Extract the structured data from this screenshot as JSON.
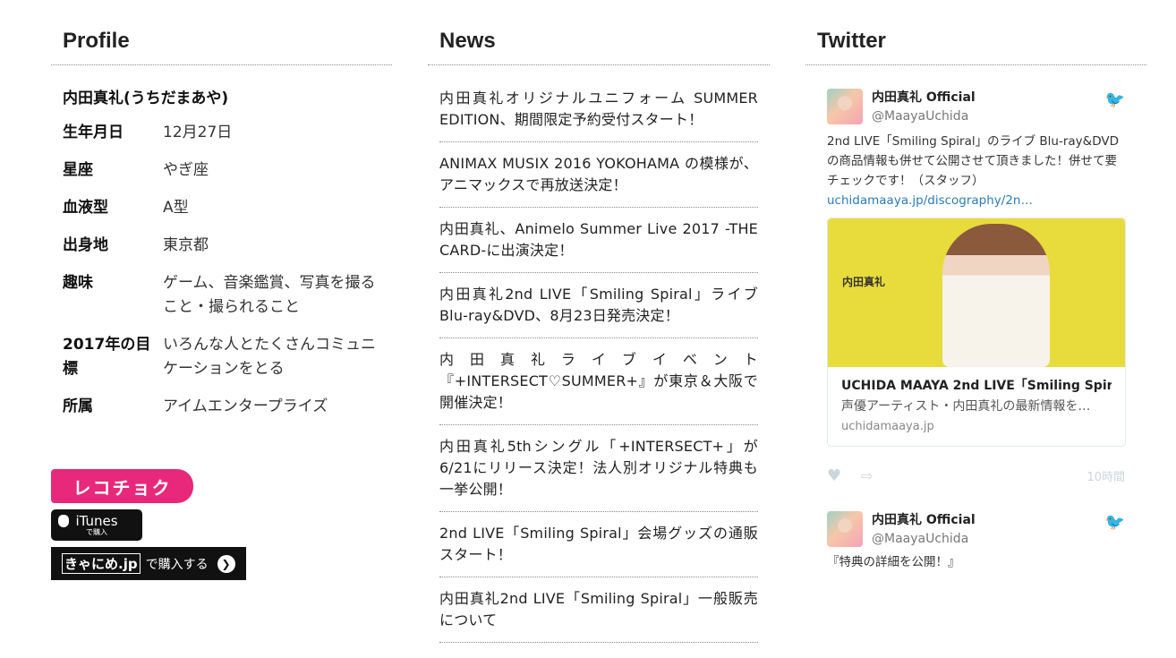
{
  "profile": {
    "title": "Profile",
    "name": "内田真礼(うちだまあや)",
    "rows": [
      {
        "key": "生年月日",
        "value": "12月27日"
      },
      {
        "key": "星座",
        "value": "やぎ座"
      },
      {
        "key": "血液型",
        "value": "A型"
      },
      {
        "key": "出身地",
        "value": "東京都"
      },
      {
        "key": "趣味",
        "value": "ゲーム、音楽鑑賞、写真を撮ること・撮られること"
      },
      {
        "key": "2017年の目標",
        "value": "いろんな人とたくさんコミュニケーションをとる"
      },
      {
        "key": "所属",
        "value": "アイムエンタープライズ"
      }
    ],
    "badges": {
      "recochoku": "レコチョク",
      "itunes": "iTunes",
      "itunes_sub": "で購入",
      "ama_logo": "きゃにめ.jp",
      "ama_text": "で購入する"
    }
  },
  "news": {
    "title": "News",
    "items": [
      "内田真礼オリジナルユニフォーム SUMMER EDITION、期間限定予約受付スタート！",
      "ANIMAX MUSIX 2016 YOKOHAMA の模様が、アニマックスで再放送決定！",
      "内田真礼、Animelo Summer Live 2017 -THE CARD-に出演決定！",
      "内田真礼2nd LIVE「Smiling Spiral」ライブBlu-ray&DVD、8月23日発売決定！",
      "内田真礼ライブイベント『+INTERSECT♡SUMMER+』が東京＆大阪で開催決定！",
      "内田真礼5thシングル「+INTERSECT+」が6/21にリリース決定！法人別オリジナル特典も一挙公開！",
      "2nd LIVE「Smiling Spiral」会場グッズの通販スタート！",
      "内田真礼2nd LIVE「Smiling Spiral」一般販売について"
    ]
  },
  "twitter": {
    "title": "Twitter",
    "tweets": [
      {
        "name": "内田真礼 Official",
        "handle": "@MaayaUchida",
        "text": "2nd LIVE「Smiling Spiral」のライブ Blu-ray&DVDの商品情報も併せて公開させて頂きました！併せて要チェックです！（スタッフ）",
        "link": "uchidamaaya.jp/discography/2n…",
        "card": {
          "image_text": "内田真礼",
          "title": "UCHIDA MAAYA 2nd LIVE「Smiling Spir…",
          "desc": "声優アーティスト・内田真礼の最新情報を…",
          "domain": "uchidamaaya.jp"
        },
        "time": "10時間"
      },
      {
        "name": "内田真礼 Official",
        "handle": "@MaayaUchida",
        "text": "『特典の詳細を公開！』"
      }
    ]
  }
}
